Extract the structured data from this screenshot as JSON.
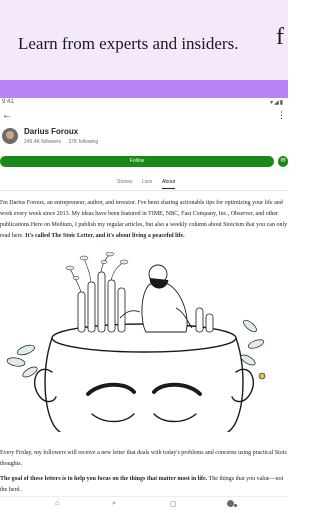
{
  "banner": {
    "text": "Learn from experts and insiders.",
    "scribble": "f"
  },
  "status_bar": {
    "time": "9:41",
    "icons": "▾◢▮"
  },
  "nav": {
    "back_icon": "←",
    "more_icon": "⋮"
  },
  "author": {
    "name": "Darius Foroux",
    "followers": "249.4K followers",
    "following": "37K following"
  },
  "buttons": {
    "follow": "Follow",
    "subscribe_icon": "✉"
  },
  "tabs": [
    {
      "label": "Stories"
    },
    {
      "label": "Lists"
    },
    {
      "label": "About"
    }
  ],
  "about": {
    "intro": "I'm Darius Foroux, an entrepreneur, author, and investor. I've been sharing actionable tips for optimizing your life and work every week since 2013. My ideas have been featured in TIME, NBC, Fast Company, Inc., Observer, and other publications.Here on Medium, I publish my regular articles, but also a weekly column about Stoicism that you can only read here. ",
    "intro_bold": "It's called The Stoic Letter, and it's about living a peaceful life.",
    "para2": "Every Friday, my followers will receive a new letter that deals with today's problems and concerns using practical Stoic thoughts.",
    "para3_bold": "The goal of these letters is to help you focus on the things that matter most in life.",
    "para3_rest": " The things that you value—not the herd."
  },
  "bottom_nav": {
    "home_icon": "⌂",
    "search_icon": "⌕",
    "write_icon": "▢"
  },
  "colors": {
    "accent_green": "#1a8917",
    "banner_bg": "#f3e9fb",
    "purple_bar": "#b884f5"
  }
}
